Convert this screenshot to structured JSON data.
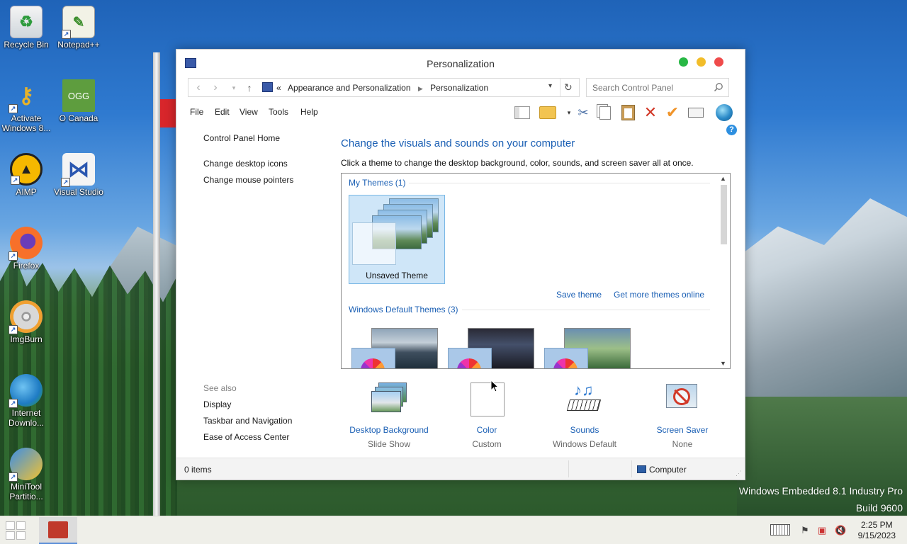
{
  "desktop": {
    "icons": [
      {
        "label": "Recycle Bin",
        "icon": "recycle-bin-icon"
      },
      {
        "label": "Notepad++",
        "icon": "notepadpp-icon"
      },
      {
        "label": "Activate Windows 8...",
        "icon": "activate-key-icon"
      },
      {
        "label": "O Canada",
        "icon": "ogg-file-icon",
        "badge": "OGG"
      },
      {
        "label": "AIMP",
        "icon": "aimp-icon"
      },
      {
        "label": "Visual Studio",
        "icon": "visual-studio-icon"
      },
      {
        "label": "Firefox",
        "icon": "firefox-icon"
      },
      {
        "label": "ImgBurn",
        "icon": "imgburn-icon"
      },
      {
        "label": "Internet Downlo...",
        "icon": "internet-download-manager-icon"
      },
      {
        "label": "MiniTool Partitio...",
        "icon": "minitool-partition-icon"
      }
    ],
    "watermark_line1": "Windows Embedded 8.1 Industry Pro",
    "watermark_line2": "Build 9600"
  },
  "window": {
    "title": "Personalization",
    "breadcrumb": {
      "prefix": "«",
      "items": [
        "Appearance and Personalization",
        "Personalization"
      ]
    },
    "search_placeholder": "Search Control Panel",
    "menu": [
      "File",
      "Edit",
      "View",
      "Tools",
      "Help"
    ],
    "toolbar_icons": [
      "layout-icon",
      "folder-icon",
      "dropdown-icon",
      "cut-icon",
      "copy-icon",
      "paste-icon",
      "delete-icon",
      "properties-check-icon",
      "rename-icon",
      "globe-icon",
      "help-icon"
    ],
    "left_pane": {
      "home": "Control Panel Home",
      "links": [
        "Change desktop icons",
        "Change mouse pointers"
      ],
      "see_also_label": "See also",
      "see_also": [
        "Display",
        "Taskbar and Navigation",
        "Ease of Access Center"
      ]
    },
    "heading": "Change the visuals and sounds on your computer",
    "subtext": "Click a theme to change the desktop background, color, sounds, and screen saver all at once.",
    "my_themes_label": "My Themes (1)",
    "unsaved_theme": "Unsaved Theme",
    "save_theme": "Save theme",
    "get_more": "Get more themes online",
    "default_themes_label": "Windows Default Themes (3)",
    "bottom": [
      {
        "title": "Desktop Background",
        "sub": "Slide Show",
        "icon": "desktop-background-icon"
      },
      {
        "title": "Color",
        "sub": "Custom",
        "icon": "color-swatch-icon"
      },
      {
        "title": "Sounds",
        "sub": "Windows Default",
        "icon": "sounds-icon"
      },
      {
        "title": "Screen Saver",
        "sub": "None",
        "icon": "screen-saver-icon"
      }
    ],
    "status": {
      "items": "0 items",
      "location": "Computer"
    }
  },
  "taskbar": {
    "time": "2:25 PM",
    "date": "9/15/2023"
  },
  "colors": {
    "link_blue": "#1a5fb4",
    "accent": "#2d7dd2"
  }
}
